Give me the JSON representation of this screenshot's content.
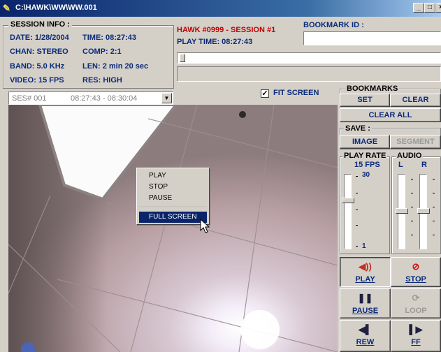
{
  "window": {
    "title": "C:\\HAWK\\WW\\WW.001",
    "controls": {
      "minimize": "_",
      "maximize": "□",
      "close": "×"
    }
  },
  "session_info": {
    "heading": "SESSION INFO :",
    "date": "DATE: 1/28/2004",
    "time": "TIME: 08:27:43",
    "chan": "CHAN: STEREO",
    "comp": "COMP: 2:1",
    "band": "BAND: 5.0 KHz",
    "len": "LEN: 2 min 20 sec",
    "video": "VIDEO: 15 FPS",
    "res": "RES: HIGH"
  },
  "header": {
    "session_title": "HAWK #0999 - SESSION #1",
    "play_time": "PLAY TIME: 08:27:43",
    "bookmark_id_label": "BOOKMARK ID :",
    "bookmark_id_value": ""
  },
  "session_select": {
    "id": "SES# 001",
    "range": "08:27:43 - 08:30:04"
  },
  "fit_screen": {
    "label": "FIT SCREEN",
    "checked": true
  },
  "context_menu": {
    "items": [
      "PLAY",
      "STOP",
      "PAUSE"
    ],
    "selected_item": "FULL SCREEN"
  },
  "bookmarks": {
    "heading": "BOOKMARKS",
    "set": "SET",
    "clear": "CLEAR",
    "clear_all": "CLEAR ALL"
  },
  "save": {
    "heading": "SAVE :",
    "image": "IMAGE",
    "segment": "SEGMENT"
  },
  "play_rate": {
    "heading": "PLAY RATE",
    "value": "15 FPS",
    "max": "30",
    "min": "1"
  },
  "audio": {
    "heading": "AUDIO",
    "left": "L",
    "right": "R"
  },
  "playback": {
    "play": "PLAY",
    "stop": "STOP",
    "pause": "PAUSE",
    "loop": "LOOP",
    "rew": "REW",
    "ff": "FF"
  },
  "icons": {
    "speaker": "speaker-icon",
    "stop": "stop-icon",
    "pause": "pause-icon",
    "loop": "loop-icon",
    "rewind": "rewind-icon",
    "fast_forward": "fast-forward-icon"
  }
}
